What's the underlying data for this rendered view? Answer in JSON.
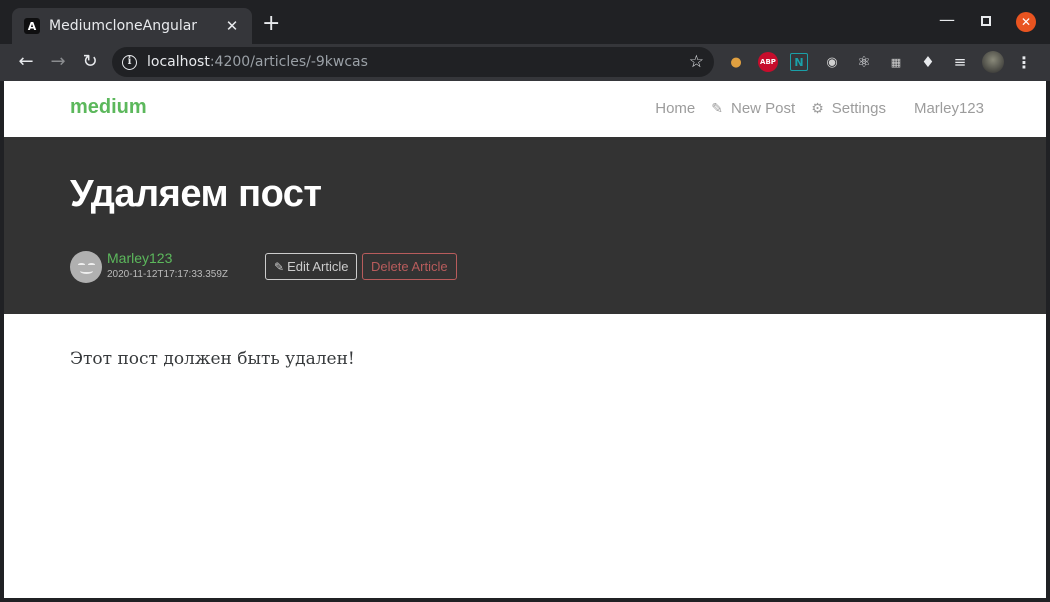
{
  "browser": {
    "tab_title": "MediumcloneAngular",
    "tab_favicon": "A",
    "tab_close": "✕",
    "new_tab": "+",
    "url_host": "localhost",
    "url_path": ":4200/articles/-9kwcas",
    "extensions": [
      "cookie-icon",
      "adblock-plus-icon",
      "n-icon",
      "glasses-icon",
      "react-icon",
      "ss-icon",
      "puzzle-icon",
      "playlist-icon",
      "profile-avatar"
    ],
    "abp_label": "ABP"
  },
  "navbar": {
    "brand": "medium",
    "links": {
      "home": "Home",
      "new_post": "New Post",
      "settings": "Settings",
      "user": "Marley123"
    }
  },
  "article": {
    "title": "Удаляем пост",
    "author": "Marley123",
    "date": "2020-11-12T17:17:33.359Z",
    "edit_label": "Edit Article",
    "delete_label": "Delete Article",
    "body": "Этот пост должен быть удален!"
  },
  "colors": {
    "brand_green": "#5cb85c",
    "banner_bg": "#333333",
    "danger": "#b85c5c"
  }
}
